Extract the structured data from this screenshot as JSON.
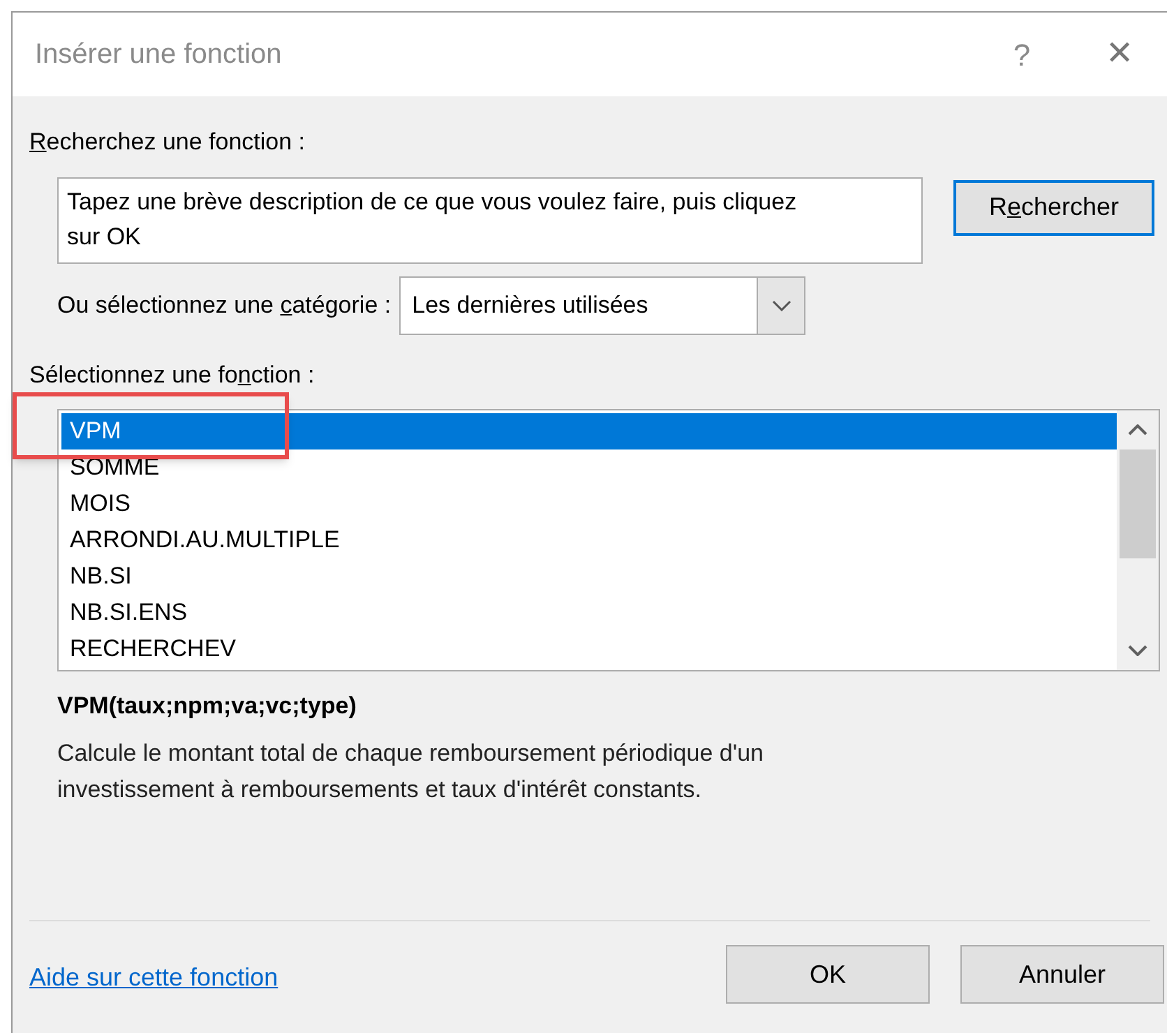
{
  "window": {
    "title": "Insérer une fonction",
    "help_glyph": "?",
    "close_glyph": "✕"
  },
  "search": {
    "label": {
      "key": "R",
      "after": "echerchez une fonction :"
    },
    "value": "Tapez une brève description de ce que vous voulez faire, puis cliquez sur OK",
    "button": {
      "before": "R",
      "key": "e",
      "after": "chercher"
    }
  },
  "category": {
    "label": {
      "before": "Ou sélectionnez une ",
      "key": "c",
      "after": "atégorie :"
    },
    "value": "Les dernières utilisées"
  },
  "functions": {
    "label": {
      "before": "Sélectionnez une fo",
      "key": "n",
      "after": "ction :"
    },
    "items": [
      {
        "name": "VPM",
        "selected": true
      },
      {
        "name": "SOMME",
        "selected": false
      },
      {
        "name": "MOIS",
        "selected": false
      },
      {
        "name": "ARRONDI.AU.MULTIPLE",
        "selected": false
      },
      {
        "name": "NB.SI",
        "selected": false
      },
      {
        "name": "NB.SI.ENS",
        "selected": false
      },
      {
        "name": "RECHERCHEV",
        "selected": false
      }
    ]
  },
  "signature": "VPM(taux;npm;va;vc;type)",
  "description": "Calcule le montant total de chaque remboursement périodique d'un investissement à remboursements et taux d'intérêt constants.",
  "help_link": "Aide sur cette fonction",
  "buttons": [
    {
      "label": "OK"
    },
    {
      "label": "Annuler"
    }
  ]
}
